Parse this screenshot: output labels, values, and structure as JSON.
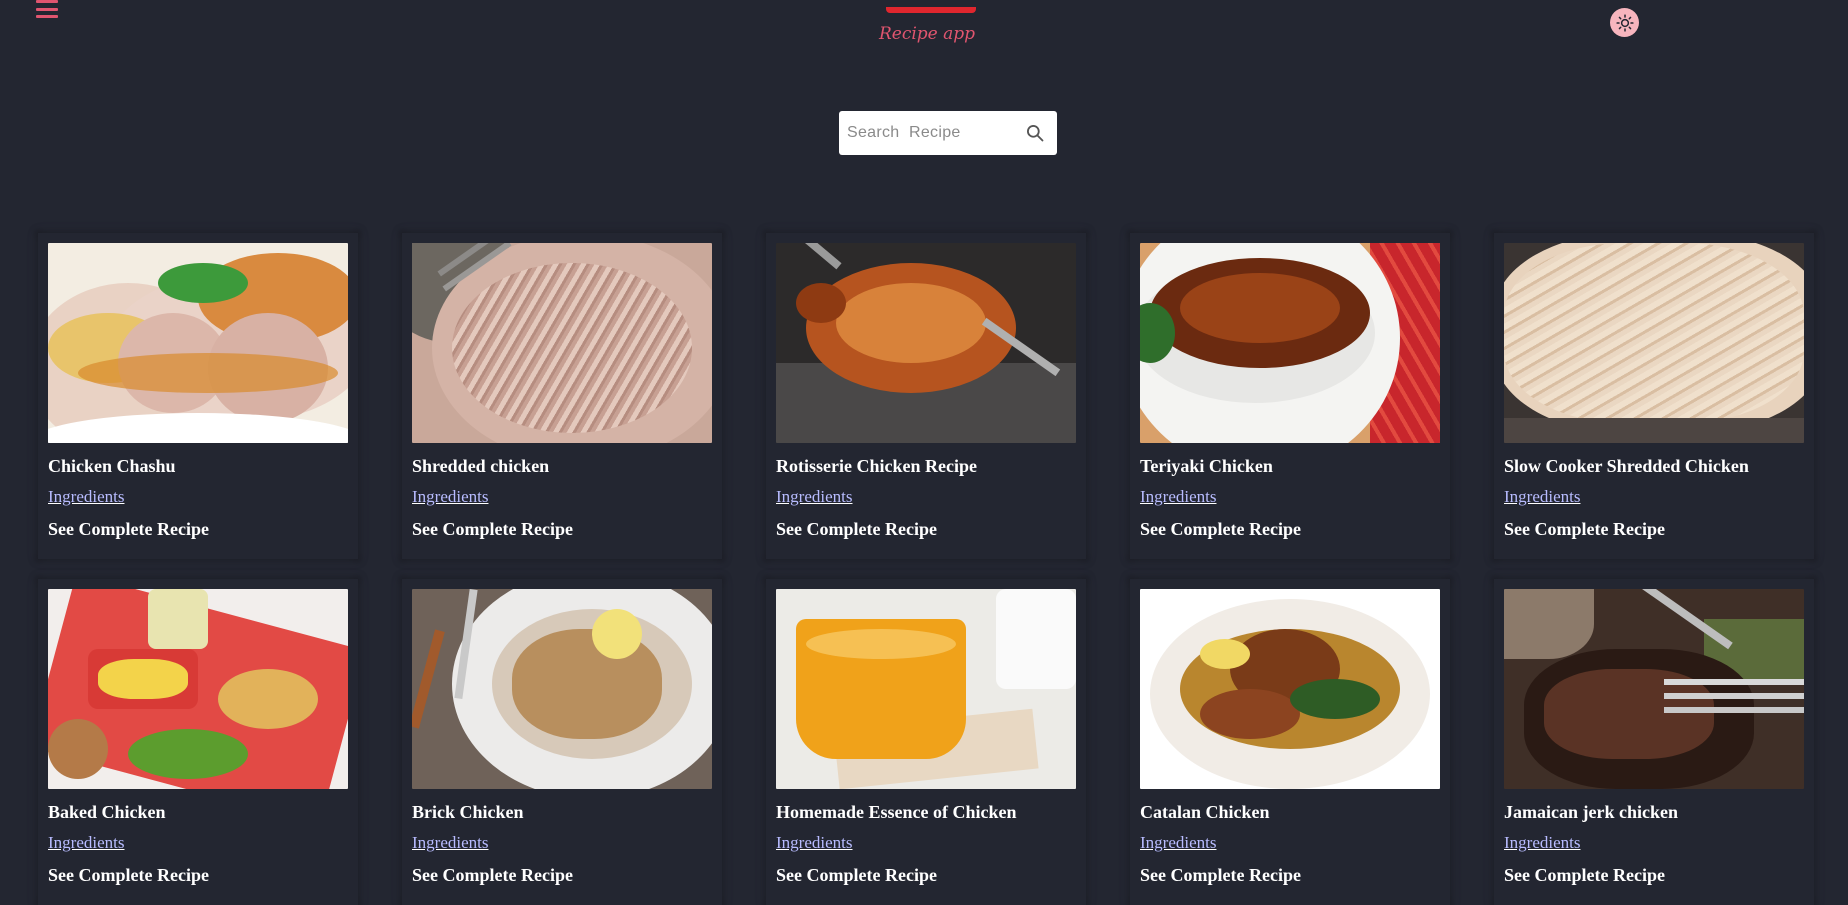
{
  "header": {
    "title": "Recipe app",
    "menu_icon": "hamburger-menu-icon",
    "theme_icon": "sun-icon"
  },
  "search": {
    "placeholder": "Search  Recipe",
    "value": "",
    "icon": "search-icon"
  },
  "cards": [
    {
      "title": "Chicken Chashu",
      "ingredients_label": "Ingredients",
      "link_label": "See Complete Recipe"
    },
    {
      "title": "Shredded chicken",
      "ingredients_label": "Ingredients",
      "link_label": "See Complete Recipe"
    },
    {
      "title": "Rotisserie Chicken Recipe",
      "ingredients_label": "Ingredients",
      "link_label": "See Complete Recipe"
    },
    {
      "title": "Teriyaki Chicken",
      "ingredients_label": "Ingredients",
      "link_label": "See Complete Recipe"
    },
    {
      "title": "Slow Cooker Shredded Chicken",
      "ingredients_label": "Ingredients",
      "link_label": "See Complete Recipe"
    },
    {
      "title": "Baked Chicken",
      "ingredients_label": "Ingredients",
      "link_label": "See Complete Recipe"
    },
    {
      "title": "Brick Chicken",
      "ingredients_label": "Ingredients",
      "link_label": "See Complete Recipe"
    },
    {
      "title": "Homemade Essence of Chicken",
      "ingredients_label": "Ingredients",
      "link_label": "See Complete Recipe"
    },
    {
      "title": "Catalan Chicken",
      "ingredients_label": "Ingredients",
      "link_label": "See Complete Recipe"
    },
    {
      "title": "Jamaican jerk chicken",
      "ingredients_label": "Ingredients",
      "link_label": "See Complete Recipe"
    }
  ],
  "colors": {
    "background": "#232631",
    "accent": "#e0556f",
    "brand_badge": "#e0262e",
    "link": "#b8bcff"
  }
}
